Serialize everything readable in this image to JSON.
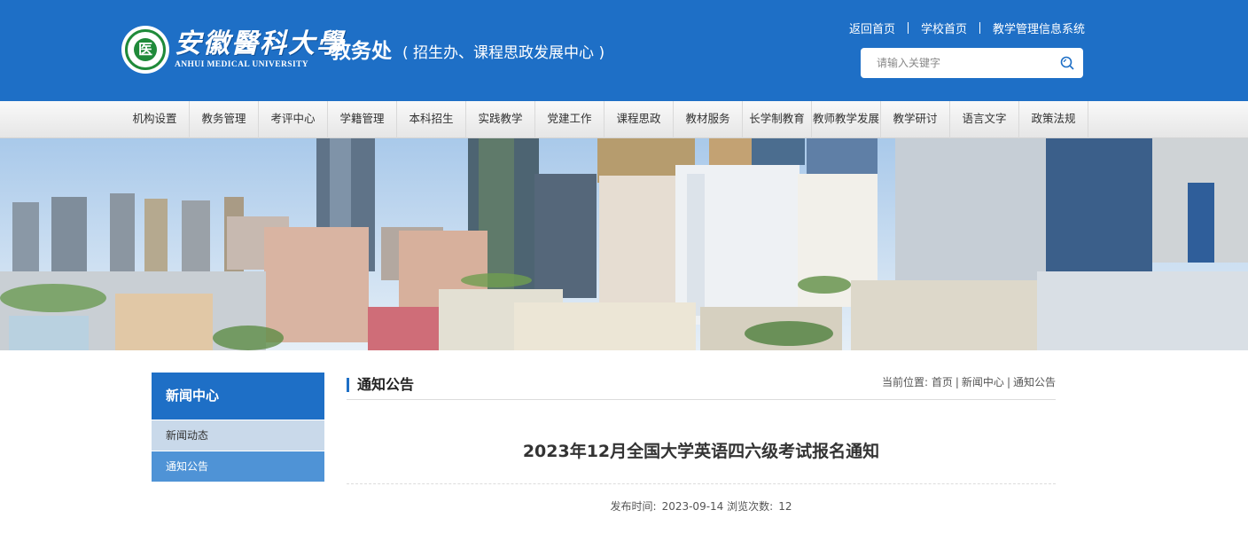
{
  "header": {
    "logo_cn": "安徽醫科大學",
    "logo_en": "ANHUI MEDICAL UNIVERSITY",
    "site_title": "教务处",
    "site_subtitle": "( 招生办、课程思政发展中心 )",
    "top_links": [
      "返回首页",
      "学校首页",
      "教学管理信息系统"
    ],
    "search_placeholder": "请输入关键字"
  },
  "nav": {
    "items": [
      "机构设置",
      "教务管理",
      "考评中心",
      "学籍管理",
      "本科招生",
      "实践教学",
      "党建工作",
      "课程思政",
      "教材服务",
      "长学制教育",
      "教师教学发展",
      "教学研讨",
      "语言文字",
      "政策法规"
    ]
  },
  "sidebar": {
    "title": "新闻中心",
    "items": [
      {
        "label": "新闻动态",
        "active": false
      },
      {
        "label": "通知公告",
        "active": true
      }
    ]
  },
  "main": {
    "section_title": "通知公告",
    "breadcrumb": {
      "prefix": "当前位置:",
      "items": [
        "首页",
        "新闻中心",
        "通知公告"
      ]
    },
    "article": {
      "title": "2023年12月全国大学英语四六级考试报名通知",
      "publish_label": "发布时间:",
      "publish_date": "2023-09-14",
      "views_label": "浏览次数:",
      "views": "12"
    }
  },
  "colors": {
    "brand_blue": "#1e6fc6",
    "sidebar_active": "#4f93d6",
    "sidebar_item": "#c9d9ea",
    "logo_green": "#1f8a3a"
  },
  "icons": {
    "search": "search-icon",
    "seal": "university-seal-icon"
  }
}
